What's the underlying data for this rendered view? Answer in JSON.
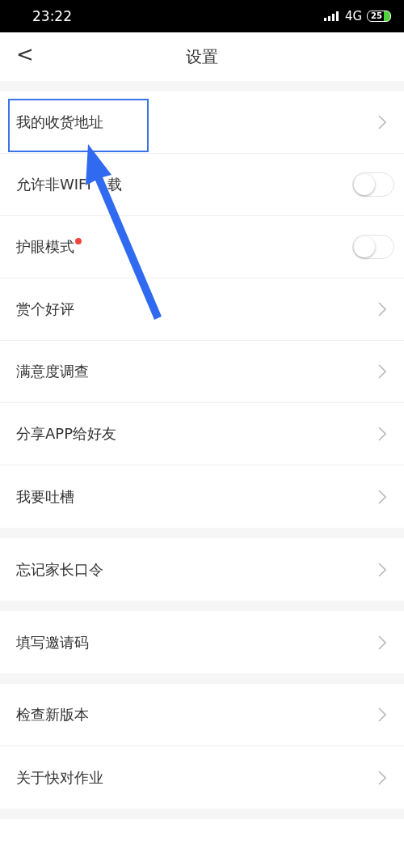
{
  "status_bar": {
    "time": "23:22",
    "network": "4G",
    "battery": "25"
  },
  "header": {
    "back": "<",
    "title": "设置"
  },
  "groups": [
    {
      "items": [
        {
          "label": "我的收货地址",
          "kind": "link",
          "highlighted": true,
          "dot": false
        },
        {
          "label_parts": [
            "允许非WIFI",
            "载"
          ],
          "kind": "toggle",
          "on": false,
          "highlighted": false,
          "dot": false
        },
        {
          "label": "护眼模式",
          "kind": "toggle",
          "on": false,
          "highlighted": false,
          "dot": true
        },
        {
          "label": "赏个好评",
          "kind": "link",
          "highlighted": false,
          "dot": false
        },
        {
          "label": "满意度调查",
          "kind": "link",
          "highlighted": false,
          "dot": false
        },
        {
          "label": "分享APP给好友",
          "kind": "link",
          "highlighted": false,
          "dot": false
        },
        {
          "label": "我要吐槽",
          "kind": "link",
          "highlighted": false,
          "dot": false
        }
      ]
    },
    {
      "items": [
        {
          "label": "忘记家长口令",
          "kind": "link",
          "highlighted": false,
          "dot": false
        }
      ]
    },
    {
      "items": [
        {
          "label": "填写邀请码",
          "kind": "link",
          "highlighted": false,
          "dot": false
        }
      ]
    },
    {
      "items": [
        {
          "label": "检查新版本",
          "kind": "link",
          "highlighted": false,
          "dot": false
        },
        {
          "label": "关于快对作业",
          "kind": "link",
          "highlighted": false,
          "dot": false
        }
      ]
    }
  ]
}
